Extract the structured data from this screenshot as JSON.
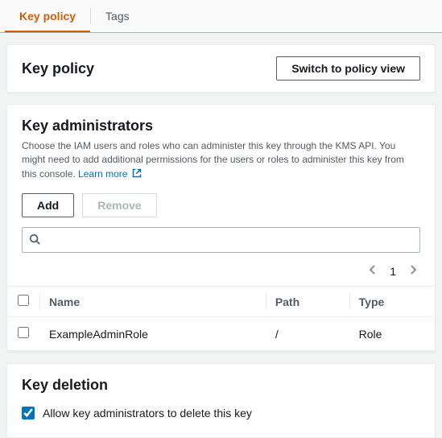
{
  "tabs": {
    "key_policy": "Key policy",
    "tags": "Tags"
  },
  "header": {
    "title": "Key policy",
    "switch_button": "Switch to policy view"
  },
  "admins": {
    "title": "Key administrators",
    "description": "Choose the IAM users and roles who can administer this key through the KMS API. You might need to add additional permissions for the users or roles to administer this key from this console.",
    "learn_more": "Learn more",
    "add_button": "Add",
    "remove_button": "Remove",
    "search_placeholder": "",
    "page_current": "1",
    "columns": {
      "name": "Name",
      "path": "Path",
      "type": "Type"
    },
    "rows": [
      {
        "name": "ExampleAdminRole",
        "path": "/",
        "type": "Role"
      }
    ]
  },
  "deletion": {
    "title": "Key deletion",
    "allow_label": "Allow key administrators to delete this key",
    "allow_checked": true
  }
}
